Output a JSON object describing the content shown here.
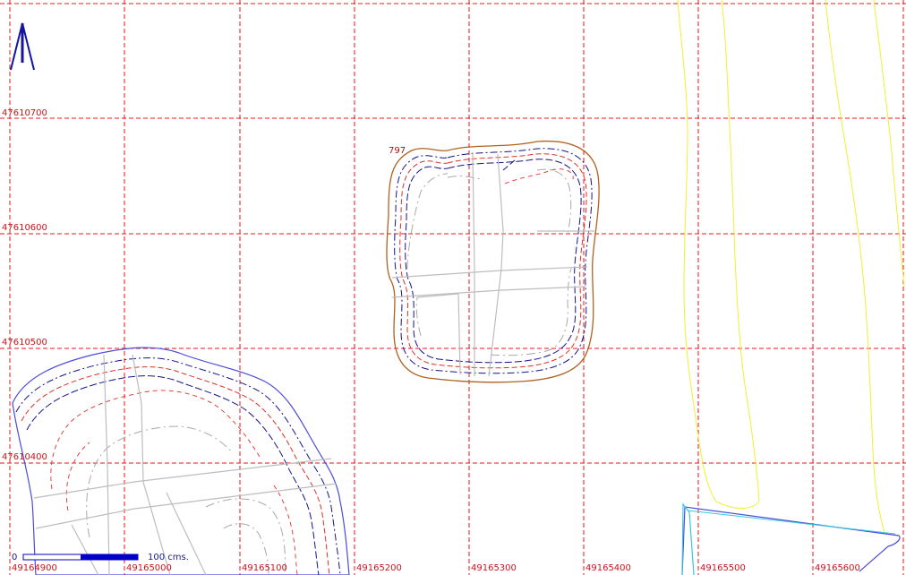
{
  "map": {
    "colors": {
      "grid": "#e8141a",
      "grid_label": "#c8141a",
      "parcel_outline": "#b0621e",
      "blue_outline": "#4b4bdc",
      "dark_blue_dash": "#14148c",
      "red_dash": "#e0302a",
      "gray_dash": "#a9a9a9",
      "yellow_line": "#f2ef32",
      "cyan_line": "#39c8dc",
      "scale_bar": "#0000c8",
      "north_arrow": "#1414a0"
    },
    "grid_labels_y": [
      "47610700",
      "47610600",
      "47610500",
      "47610400"
    ],
    "grid_labels_x": [
      "49164900",
      "49165000",
      "49165100",
      "49165200",
      "49165300",
      "49165400",
      "49165500",
      "49165600"
    ],
    "parcel_label": "797",
    "scale_bar": {
      "start_label": "0",
      "end_label": "100 cms."
    },
    "north_arrow_icon": "north-arrow-icon"
  }
}
